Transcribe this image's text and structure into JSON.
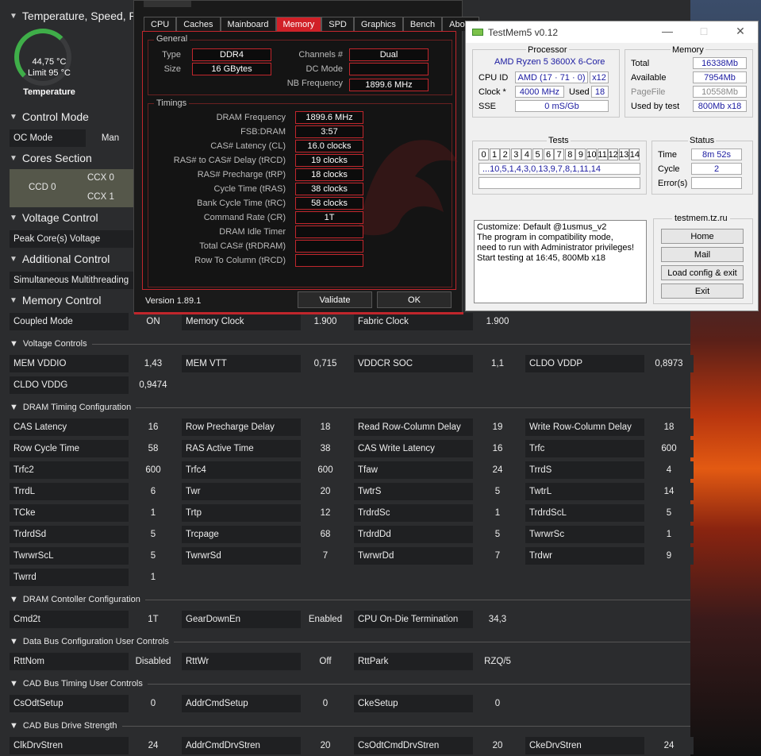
{
  "ryzen": {
    "temp_section": "Temperature, Speed, P",
    "temp_value": "44,75 °C",
    "temp_limit": "Limit 95 °C",
    "temp_label": "Temperature",
    "control_mode": "Control Mode",
    "oc_mode": "OC Mode",
    "oc_mode_val": "Man",
    "cores_section": "Cores Section",
    "ccd0": "CCD 0",
    "ccx0": "CCX 0",
    "ccx1": "CCX 1",
    "voltage_control": "Voltage Control",
    "peak_voltage": "Peak Core(s) Voltage",
    "additional_control": "Additional Control",
    "smt": "Simultaneous Multithreading",
    "memory_control": "Memory Control",
    "mem_row": [
      [
        "Coupled Mode",
        "ON"
      ],
      [
        "Memory Clock",
        "1.900"
      ],
      [
        "Fabric Clock",
        "1.900"
      ]
    ],
    "voltage_controls": "Voltage Controls",
    "volt_rows": [
      [
        "MEM VDDIO",
        "1,43"
      ],
      [
        "MEM VTT",
        "0,715"
      ],
      [
        "VDDCR SOC",
        "1,1"
      ],
      [
        "CLDO VDDP",
        "0,8973"
      ],
      [
        "CLDO VDDG",
        "0,9474"
      ]
    ],
    "dram_timing": "DRAM Timing Configuration",
    "timing_rows": [
      [
        "CAS Latency",
        "16"
      ],
      [
        "Row Precharge Delay",
        "18"
      ],
      [
        "Read Row-Column Delay",
        "19"
      ],
      [
        "Write Row-Column Delay",
        "18"
      ],
      [
        "Row Cycle Time",
        "58"
      ],
      [
        "RAS Active Time",
        "38"
      ],
      [
        "CAS Write Latency",
        "16"
      ],
      [
        "Trfc",
        "600"
      ],
      [
        "Trfc2",
        "600"
      ],
      [
        "Trfc4",
        "600"
      ],
      [
        "Tfaw",
        "24"
      ],
      [
        "TrrdS",
        "4"
      ],
      [
        "TrrdL",
        "6"
      ],
      [
        "Twr",
        "20"
      ],
      [
        "TwtrS",
        "5"
      ],
      [
        "TwtrL",
        "14"
      ],
      [
        "TCke",
        "1"
      ],
      [
        "Trtp",
        "12"
      ],
      [
        "TrdrdSc",
        "1"
      ],
      [
        "TrdrdScL",
        "5"
      ],
      [
        "TrdrdSd",
        "5"
      ],
      [
        "Trcpage",
        "68"
      ],
      [
        "TrdrdDd",
        "5"
      ],
      [
        "TwrwrSc",
        "1"
      ],
      [
        "TwrwrScL",
        "5"
      ],
      [
        "TwrwrSd",
        "7"
      ],
      [
        "TwrwrDd",
        "7"
      ],
      [
        "Trdwr",
        "9"
      ],
      [
        "Twrrd",
        "1"
      ]
    ],
    "dram_ctrl": "DRAM Contoller Configuration",
    "ctrl_rows": [
      [
        "Cmd2t",
        "1T"
      ],
      [
        "GearDownEn",
        "Enabled"
      ],
      [
        "CPU On-Die Termination",
        "34,3"
      ]
    ],
    "data_bus": "Data Bus Configuration User Controls",
    "bus_rows": [
      [
        "RttNom",
        "Disabled"
      ],
      [
        "RttWr",
        "Off"
      ],
      [
        "RttPark",
        "RZQ/5"
      ]
    ],
    "cad_timing": "CAD Bus Timing User Controls",
    "cad_rows": [
      [
        "CsOdtSetup",
        "0"
      ],
      [
        "AddrCmdSetup",
        "0"
      ],
      [
        "CkeSetup",
        "0"
      ]
    ],
    "cad_drive": "CAD Bus Drive Strength",
    "drive_rows": [
      [
        "ClkDrvStren",
        "24"
      ],
      [
        "AddrCmdDrvStren",
        "20"
      ],
      [
        "CsOdtCmdDrvStren",
        "20"
      ],
      [
        "CkeDrvStren",
        "24"
      ]
    ]
  },
  "zen": {
    "tabs": [
      "CPU",
      "Caches",
      "Mainboard",
      "Memory",
      "SPD",
      "Graphics",
      "Bench",
      "About"
    ],
    "general": "General",
    "type_l": "Type",
    "type_v": "DDR4",
    "size_l": "Size",
    "size_v": "16 GBytes",
    "chan_l": "Channels #",
    "chan_v": "Dual",
    "dc_l": "DC Mode",
    "dc_v": "",
    "nb_l": "NB Frequency",
    "nb_v": "1899.6 MHz",
    "timings": "Timings",
    "rows": [
      [
        "DRAM Frequency",
        "1899.6 MHz"
      ],
      [
        "FSB:DRAM",
        "3:57"
      ],
      [
        "CAS# Latency (CL)",
        "16.0 clocks"
      ],
      [
        "RAS# to CAS# Delay (tRCD)",
        "19 clocks"
      ],
      [
        "RAS# Precharge (tRP)",
        "18 clocks"
      ],
      [
        "Cycle Time (tRAS)",
        "38 clocks"
      ],
      [
        "Bank Cycle Time (tRC)",
        "58 clocks"
      ],
      [
        "Command Rate (CR)",
        "1T"
      ],
      [
        "DRAM Idle Timer",
        ""
      ],
      [
        "Total CAS# (tRDRAM)",
        ""
      ],
      [
        "Row To Column (tRCD)",
        ""
      ]
    ],
    "version": "Version 1.89.1",
    "validate": "Validate",
    "ok": "OK"
  },
  "tm": {
    "title": "TestMem5 v0.12",
    "processor": "Processor",
    "cpu_name": "AMD Ryzen 5 3600X 6-Core",
    "cpuid_l": "CPU ID",
    "cpuid_v": "AMD  (17 · 71 · 0)",
    "cpuid_x": "x12",
    "clock_l": "Clock *",
    "clock_v": "4000 MHz",
    "used_l": "Used",
    "used_v": "18",
    "sse_l": "SSE",
    "sse_v": "0 mS/Gb",
    "memory": "Memory",
    "total_l": "Total",
    "total_v": "16338Mb",
    "avail_l": "Available",
    "avail_v": "7954Mb",
    "page_l": "PageFile",
    "page_v": "10558Mb",
    "usedby_l": "Used by test",
    "usedby_v": "800Mb x18",
    "tests": "Tests",
    "test_nums": [
      "0",
      "1",
      "2",
      "3",
      "4",
      "5",
      "6",
      "7",
      "8",
      "9",
      "10",
      "11",
      "12",
      "13",
      "14"
    ],
    "test_seq": "...10,5,1,4,3,0,13,9,7,8,1,11,14",
    "status": "Status",
    "time_l": "Time",
    "time_v": "8m 52s",
    "cycle_l": "Cycle",
    "cycle_v": "2",
    "err_l": "Error(s)",
    "err_v": "",
    "log": "Customize: Default @1usmus_v2\nThe program in compatibility mode,\nneed to run with Administrator privileges!\nStart testing at 16:45, 800Mb x18",
    "site": "testmem.tz.ru",
    "home": "Home",
    "mail": "Mail",
    "load": "Load config & exit",
    "exit": "Exit"
  }
}
